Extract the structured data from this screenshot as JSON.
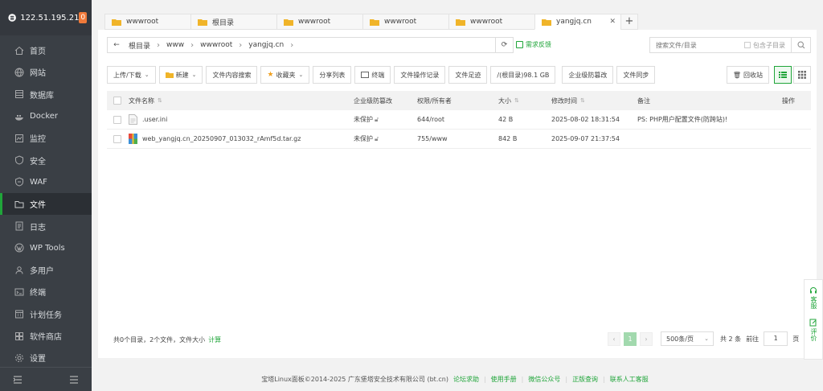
{
  "sidebar": {
    "ip": "122.51.195.21",
    "badge": "0",
    "items": [
      {
        "label": "首页",
        "icon": "home-icon"
      },
      {
        "label": "网站",
        "icon": "globe-icon"
      },
      {
        "label": "数据库",
        "icon": "database-icon"
      },
      {
        "label": "Docker",
        "icon": "docker-icon"
      },
      {
        "label": "监控",
        "icon": "monitor-icon"
      },
      {
        "label": "安全",
        "icon": "shield-icon"
      },
      {
        "label": "WAF",
        "icon": "waf-icon"
      },
      {
        "label": "文件",
        "icon": "folder-icon",
        "active": true
      },
      {
        "label": "日志",
        "icon": "log-icon"
      },
      {
        "label": "WP Tools",
        "icon": "wordpress-icon"
      },
      {
        "label": "多用户",
        "icon": "users-icon"
      },
      {
        "label": "终端",
        "icon": "terminal-icon"
      },
      {
        "label": "计划任务",
        "icon": "calendar-icon"
      },
      {
        "label": "软件商店",
        "icon": "store-icon"
      },
      {
        "label": "设置",
        "icon": "gear-icon"
      }
    ]
  },
  "tabs": [
    {
      "label": "wwwroot"
    },
    {
      "label": "根目录"
    },
    {
      "label": "wwwroot"
    },
    {
      "label": "wwwroot"
    },
    {
      "label": "wwwroot"
    },
    {
      "label": "yangjq.cn",
      "active": true
    }
  ],
  "addressbar": {
    "crumbs": [
      "根目录",
      "www",
      "wwwroot",
      "yangjq.cn"
    ],
    "feedback": "需求反馈"
  },
  "search": {
    "placeholder": "搜索文件/目录",
    "include_sub": "包含子目录"
  },
  "toolbar": {
    "upload": "上传/下载",
    "new": "新建",
    "content_search": "文件内容搜索",
    "favorites": "收藏夹",
    "share_list": "分享列表",
    "terminal": "终端",
    "op_log": "文件操作记录",
    "footprint": "文件足迹",
    "disk": "/(根目录)98.1 GB",
    "enterprise": "企业级防篡改",
    "sync": "文件同步",
    "recycle": "回收站"
  },
  "table": {
    "headers": {
      "name": "文件名称",
      "protect": "企业级防篡改",
      "perm": "权限/所有者",
      "size": "大小",
      "mtime": "修改时间",
      "note": "备注",
      "action": "操作"
    },
    "rows": [
      {
        "name": ".user.ini",
        "protect": "未保护",
        "perm": "644/root",
        "size": "42 B",
        "mtime": "2025-08-02 18:31:54",
        "note": "PS: PHP用户配置文件(防跨站)!",
        "icon": "file-icon"
      },
      {
        "name": "web_yangjq.cn_20250907_013032_rAmf5d.tar.gz",
        "protect": "未保护",
        "perm": "755/www",
        "size": "842 B",
        "mtime": "2025-09-07 21:37:54",
        "note": "",
        "icon": "archive-icon"
      }
    ]
  },
  "summary": {
    "text": "共0个目录，2个文件，文件大小",
    "calc": "计算"
  },
  "pager": {
    "page": "1",
    "per_page": "500条/页",
    "total": "共 2 条",
    "goto": "前往",
    "page_input": "1",
    "page_unit": "页"
  },
  "float": {
    "service": "客服",
    "review": "评价"
  },
  "footer": {
    "copyright": "宝塔Linux面板©2014-2025 广东堡塔安全技术有限公司 (bt.cn)",
    "links": [
      "论坛求助",
      "使用手册",
      "微信公众号",
      "正版查询",
      "联系人工客服"
    ]
  },
  "colors": {
    "accent": "#20a53a",
    "sidebar": "#3a3f45",
    "badge": "#f07a3a"
  }
}
